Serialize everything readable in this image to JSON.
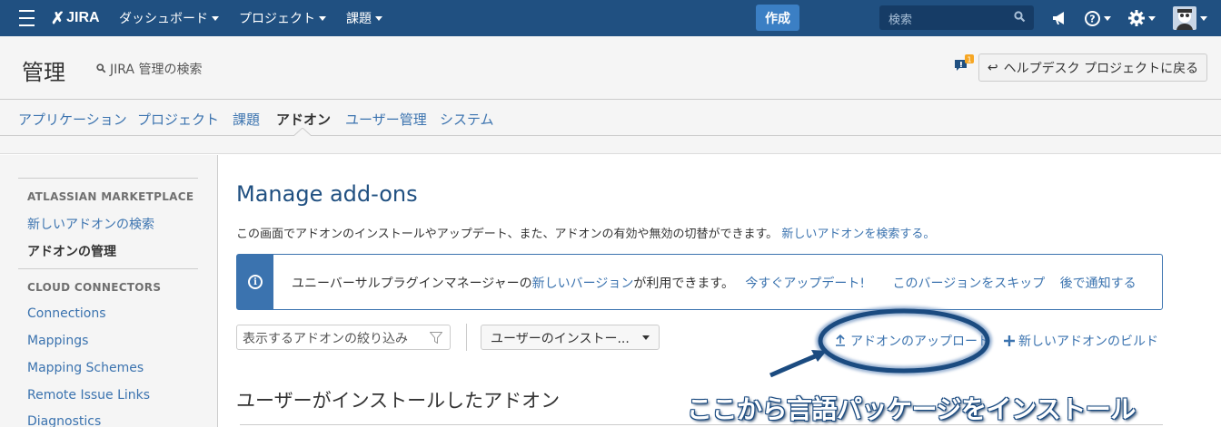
{
  "topbar": {
    "logo": "JIRA",
    "logo_mark": "✗",
    "nav": [
      "ダッシュボード",
      "プロジェクト",
      "課題"
    ],
    "create_label": "作成",
    "search_placeholder": "検索"
  },
  "header": {
    "title": "管理",
    "admin_search": "JIRA 管理の検索",
    "notification_count": "1",
    "back_button": "ヘルプデスク プロジェクトに戻る"
  },
  "tabs": [
    "アプリケーション",
    "プロジェクト",
    "課題",
    "アドオン",
    "ユーザー管理",
    "システム"
  ],
  "sidebar": {
    "marketplace_heading": "ATLASSIAN MARKETPLACE",
    "marketplace_items": [
      "新しいアドオンの検索",
      "アドオンの管理"
    ],
    "cloud_heading": "CLOUD CONNECTORS",
    "cloud_items": [
      "Connections",
      "Mappings",
      "Mapping Schemes",
      "Remote Issue Links",
      "Diagnostics"
    ]
  },
  "main": {
    "title": "Manage add-ons",
    "description": "この画面でアドオンのインストールやアップデート、また、アドオンの有効や無効の切替ができます。",
    "description_link": "新しいアドオンを検索する。",
    "banner": {
      "text_before": "ユニーバーサルプラグインマネージャーの",
      "text_link": "新しいバージョン",
      "text_after": "が利用できます。",
      "update_now": "今すぐアップデート!",
      "skip": "このバージョンをスキップ",
      "remind_later": "後で通知する"
    },
    "filter_placeholder": "表示するアドオンの絞り込み",
    "select_value": "ユーザーのインストー...",
    "upload_label": "アドオンのアップロード",
    "build_label": "新しいアドオンのビルド",
    "section_title": "ユーザーがインストールしたアドオン"
  },
  "annotation": {
    "text": "ここから言語パッケージをインストール",
    "color": "#1b4b80"
  }
}
